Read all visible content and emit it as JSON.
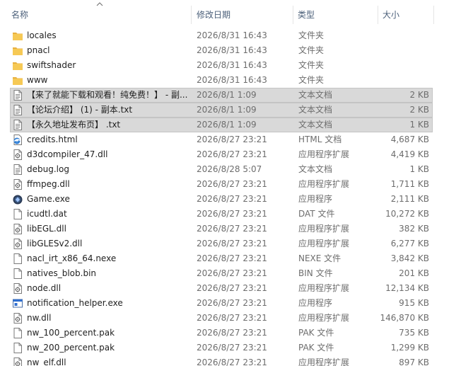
{
  "columns": {
    "name": "名称",
    "date": "修改日期",
    "type": "类型",
    "size": "大小"
  },
  "colors": {
    "header_text": "#4c607a",
    "selected_row": "#d9d9d9",
    "folder": "#f6c955"
  },
  "files": [
    {
      "name": "locales",
      "date": "2026/8/31 16:43",
      "type": "文件夹",
      "size": "",
      "icon": "folder-icon",
      "selected": false
    },
    {
      "name": "pnacl",
      "date": "2026/8/31 16:43",
      "type": "文件夹",
      "size": "",
      "icon": "folder-icon",
      "selected": false
    },
    {
      "name": "swiftshader",
      "date": "2026/8/31 16:43",
      "type": "文件夹",
      "size": "",
      "icon": "folder-icon",
      "selected": false
    },
    {
      "name": "www",
      "date": "2026/8/31 16:43",
      "type": "文件夹",
      "size": "",
      "icon": "folder-icon",
      "selected": false
    },
    {
      "name": "【来了就能下载和观看！纯免费！】 - 副...",
      "date": "2026/8/1 1:09",
      "type": "文本文档",
      "size": "2 KB",
      "icon": "text-file-icon",
      "selected": true
    },
    {
      "name": "【论坛介绍】 (1) - 副本.txt",
      "date": "2026/8/1 1:09",
      "type": "文本文档",
      "size": "2 KB",
      "icon": "text-file-icon",
      "selected": true
    },
    {
      "name": "【永久地址发布页】 .txt",
      "date": "2026/8/1 1:09",
      "type": "文本文档",
      "size": "1 KB",
      "icon": "text-file-icon",
      "selected": true
    },
    {
      "name": "credits.html",
      "date": "2026/8/27 23:21",
      "type": "HTML 文档",
      "size": "4,687 KB",
      "icon": "html-file-icon",
      "selected": false
    },
    {
      "name": "d3dcompiler_47.dll",
      "date": "2026/8/27 23:21",
      "type": "应用程序扩展",
      "size": "4,419 KB",
      "icon": "dll-file-icon",
      "selected": false
    },
    {
      "name": "debug.log",
      "date": "2026/8/28 5:07",
      "type": "文本文档",
      "size": "1 KB",
      "icon": "text-file-icon",
      "selected": false
    },
    {
      "name": "ffmpeg.dll",
      "date": "2026/8/27 23:21",
      "type": "应用程序扩展",
      "size": "1,711 KB",
      "icon": "dll-file-icon",
      "selected": false
    },
    {
      "name": "Game.exe",
      "date": "2026/8/27 23:21",
      "type": "应用程序",
      "size": "2,111 KB",
      "icon": "game-exe-icon",
      "selected": false
    },
    {
      "name": "icudtl.dat",
      "date": "2026/8/27 23:21",
      "type": "DAT 文件",
      "size": "10,272 KB",
      "icon": "blank-file-icon",
      "selected": false
    },
    {
      "name": "libEGL.dll",
      "date": "2026/8/27 23:21",
      "type": "应用程序扩展",
      "size": "382 KB",
      "icon": "dll-file-icon",
      "selected": false
    },
    {
      "name": "libGLESv2.dll",
      "date": "2026/8/27 23:21",
      "type": "应用程序扩展",
      "size": "6,277 KB",
      "icon": "dll-file-icon",
      "selected": false
    },
    {
      "name": "nacl_irt_x86_64.nexe",
      "date": "2026/8/27 23:21",
      "type": "NEXE 文件",
      "size": "3,842 KB",
      "icon": "blank-file-icon",
      "selected": false
    },
    {
      "name": "natives_blob.bin",
      "date": "2026/8/27 23:21",
      "type": "BIN 文件",
      "size": "201 KB",
      "icon": "blank-file-icon",
      "selected": false
    },
    {
      "name": "node.dll",
      "date": "2026/8/27 23:21",
      "type": "应用程序扩展",
      "size": "12,134 KB",
      "icon": "dll-file-icon",
      "selected": false
    },
    {
      "name": "notification_helper.exe",
      "date": "2026/8/27 23:21",
      "type": "应用程序",
      "size": "915 KB",
      "icon": "exe-window-icon",
      "selected": false
    },
    {
      "name": "nw.dll",
      "date": "2026/8/27 23:21",
      "type": "应用程序扩展",
      "size": "146,870 KB",
      "icon": "dll-file-icon",
      "selected": false
    },
    {
      "name": "nw_100_percent.pak",
      "date": "2026/8/27 23:21",
      "type": "PAK 文件",
      "size": "735 KB",
      "icon": "blank-file-icon",
      "selected": false
    },
    {
      "name": "nw_200_percent.pak",
      "date": "2026/8/27 23:21",
      "type": "PAK 文件",
      "size": "1,299 KB",
      "icon": "blank-file-icon",
      "selected": false
    },
    {
      "name": "nw_elf.dll",
      "date": "2026/8/27 23:21",
      "type": "应用程序扩展",
      "size": "897 KB",
      "icon": "dll-file-icon",
      "selected": false
    }
  ]
}
